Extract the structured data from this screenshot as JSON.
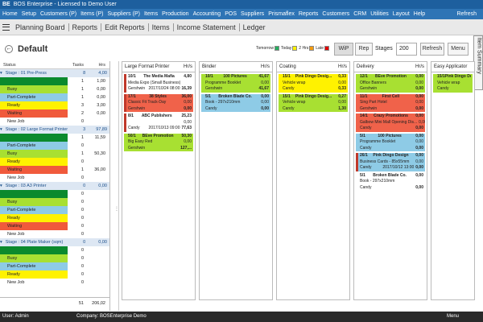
{
  "window": {
    "app_logo": "BE",
    "title": "BOS Enterprise - Licensed to Demo User"
  },
  "menu": {
    "items": [
      "Home",
      "Setup",
      "Customers (P)",
      "Items (P)",
      "Suppliers (P)",
      "Items",
      "Production",
      "Accounting",
      "POS",
      "Suppliers",
      "Prismaflex",
      "Reports",
      "Customers",
      "CRM",
      "Utilities",
      "Layout",
      "Help"
    ],
    "right": "Refresh"
  },
  "nav": {
    "items": [
      "Planning Board",
      "Reports",
      "Edit Reports",
      "Items",
      "Income Statement",
      "Ledger"
    ]
  },
  "toolbar": {
    "title": "Default",
    "back_icon": "arrow-left-icon",
    "legend": [
      {
        "label": "Tomorrow",
        "color": "#27ae60"
      },
      {
        "label": "Today",
        "color": "#fff200"
      },
      {
        "label": "2 Hrs",
        "color": "#f39c12"
      },
      {
        "label": "Late",
        "color": "#e00000"
      }
    ],
    "wip": "WiP",
    "rep": "Rep",
    "stages_label": "Stages",
    "stages_value": "200",
    "refresh": "Refresh",
    "menu": "Menu"
  },
  "side_tab": "Item Summary",
  "left": {
    "headers": {
      "status": "Status",
      "tasks": "Tasks",
      "hrs": "Hrs"
    },
    "rows": [
      {
        "t": "stage",
        "s": "Stage : 01 Pre-Press",
        "n": "8",
        "h": "4,00"
      },
      {
        "t": "status",
        "s": "",
        "n": "1",
        "h": "1,00",
        "bg": "#0b8a2d"
      },
      {
        "t": "status",
        "s": "Busy",
        "n": "1",
        "h": "0,00",
        "bg": "#a8e032"
      },
      {
        "t": "status",
        "s": "Part-Complete",
        "n": "1",
        "h": "0,00",
        "bg": "#8ecbe6"
      },
      {
        "t": "status",
        "s": "Ready",
        "n": "3",
        "h": "3,00",
        "bg": "#fff200"
      },
      {
        "t": "status",
        "s": "Waiting",
        "n": "2",
        "h": "0,00",
        "bg": "#f05a3c"
      },
      {
        "t": "status",
        "s": "New Job",
        "n": "0",
        "h": "",
        "bg": "#ffffff"
      },
      {
        "t": "stage",
        "s": "Stage : 02 Large Format Printer",
        "n": "3",
        "h": "97,89"
      },
      {
        "t": "status",
        "s": "",
        "n": "1",
        "h": "11,59",
        "bg": "#0b8a2d"
      },
      {
        "t": "status",
        "s": "Part-Complete",
        "n": "0",
        "h": "",
        "bg": "#8ecbe6"
      },
      {
        "t": "status",
        "s": "Busy",
        "n": "1",
        "h": "50,30",
        "bg": "#a8e032"
      },
      {
        "t": "status",
        "s": "Ready",
        "n": "0",
        "h": "",
        "bg": "#fff200"
      },
      {
        "t": "status",
        "s": "Waiting",
        "n": "1",
        "h": "36,00",
        "bg": "#f05a3c"
      },
      {
        "t": "status",
        "s": "New Job",
        "n": "0",
        "h": "",
        "bg": "#ffffff"
      },
      {
        "t": "stage",
        "s": "Stage : 03 A3 Printer",
        "n": "0",
        "h": "0,00"
      },
      {
        "t": "status",
        "s": "",
        "n": "0",
        "h": "",
        "bg": "#0b8a2d"
      },
      {
        "t": "status",
        "s": "Busy",
        "n": "0",
        "h": "",
        "bg": "#a8e032"
      },
      {
        "t": "status",
        "s": "Part-Complete",
        "n": "0",
        "h": "",
        "bg": "#8ecbe6"
      },
      {
        "t": "status",
        "s": "Ready",
        "n": "0",
        "h": "",
        "bg": "#fff200"
      },
      {
        "t": "status",
        "s": "Waiting",
        "n": "0",
        "h": "",
        "bg": "#f05a3c"
      },
      {
        "t": "status",
        "s": "New Job",
        "n": "0",
        "h": "",
        "bg": "#ffffff"
      },
      {
        "t": "stage",
        "s": "Stage : 04 Plate Maker (sqm)",
        "n": "0",
        "h": "0,00"
      },
      {
        "t": "status",
        "s": "",
        "n": "0",
        "h": "",
        "bg": "#0b8a2d"
      },
      {
        "t": "status",
        "s": "Busy",
        "n": "0",
        "h": "",
        "bg": "#a8e032"
      },
      {
        "t": "status",
        "s": "Part-Complete",
        "n": "0",
        "h": "",
        "bg": "#8ecbe6"
      },
      {
        "t": "status",
        "s": "Ready",
        "n": "0",
        "h": "",
        "bg": "#fff200"
      },
      {
        "t": "status",
        "s": "New Job",
        "n": "0",
        "h": "",
        "bg": "#ffffff"
      }
    ],
    "footer": {
      "tasks": "51",
      "hrs": "206,02"
    }
  },
  "columns": [
    {
      "name": "Large Format Printer",
      "hrs": "Hr/s",
      "cards": [
        {
          "bg": "#ffffff",
          "bar": "#c0392b",
          "rows": [
            [
              "10/1",
              "The Media Mafia",
              "4,80"
            ],
            [
              "Media Expo (Small Business)",
              "",
              ""
            ],
            [
              "Gershwin",
              "2017/10/24   08:00",
              "16,39"
            ]
          ]
        },
        {
          "bg": "#f0624a",
          "bar": "#c0392b",
          "rows": [
            [
              "17/1",
              "38 Styles",
              "36,00"
            ],
            [
              "Classic Fit Track-Day",
              "",
              "0,00"
            ],
            [
              "Gershwin",
              "",
              "0,00"
            ]
          ]
        },
        {
          "bg": "#ffffff",
          "bar": "#c0392b",
          "rows": [
            [
              "8/1",
              "ABC Publishers",
              "25,23"
            ],
            [
              "",
              "",
              "0,00"
            ],
            [
              "Candy",
              "2017/10/13   09:00",
              "77,63"
            ]
          ]
        },
        {
          "bg": "#a8e032",
          "bar": "#a8e032",
          "rows": [
            [
              "50/1",
              "BEve Promotion",
              "50,30"
            ],
            [
              "Big Easy Red",
              "",
              "0,00"
            ],
            [
              "Gershwin",
              "",
              "127,..."
            ]
          ]
        }
      ]
    },
    {
      "name": "Binder",
      "hrs": "Hr/s",
      "cards": [
        {
          "bg": "#a8e032",
          "bar": "#a8e032",
          "rows": [
            [
              "10/1",
              "100 Pictures",
              "41,67"
            ],
            [
              "Programme Booklet",
              "",
              "0,00"
            ],
            [
              "Gershwin",
              "",
              "41,67"
            ]
          ]
        },
        {
          "bg": "#8ecbe6",
          "bar": "#8ecbe6",
          "rows": [
            [
              "5/1",
              "Broken Blade Co.",
              "0,00"
            ],
            [
              "Book - 297x210mm",
              "",
              "0,00"
            ],
            [
              "Candy",
              "",
              "0,00"
            ]
          ]
        }
      ]
    },
    {
      "name": "Coating",
      "hrs": "Hr/s",
      "cards": [
        {
          "bg": "#fff200",
          "bar": "#fff200",
          "rows": [
            [
              "15/1",
              "Pink Dingo Desig...",
              "0,33"
            ],
            [
              "Vehicle wrap",
              "",
              "0,00"
            ],
            [
              "Candy",
              "",
              "0,33"
            ]
          ]
        },
        {
          "bg": "#a8e032",
          "bar": "#a8e032",
          "rows": [
            [
              "15/1",
              "Pink Dingo Desig...",
              "0,27"
            ],
            [
              "Vehicle wrap",
              "",
              "0,00"
            ],
            [
              "Candy",
              "",
              "1,30"
            ]
          ]
        }
      ]
    },
    {
      "name": "Delivery",
      "hrs": "Hr/s",
      "cards": [
        {
          "bg": "#a8e032",
          "bar": "#a8e032",
          "rows": [
            [
              "12/1",
              "BEve Promotion",
              "0,00"
            ],
            [
              "Office Banners",
              "",
              "0,00"
            ],
            [
              "Gershwin",
              "",
              "0,00"
            ]
          ]
        },
        {
          "bg": "#f0624a",
          "bar": "#f0624a",
          "rows": [
            [
              "11/1",
              "First Cell",
              "0,00"
            ],
            [
              "Sing Part Hotel",
              "",
              "0,00"
            ],
            [
              "Gershwin",
              "",
              "0,00"
            ]
          ]
        },
        {
          "bg": "#f0624a",
          "bar": "#f0624a",
          "rows": [
            [
              "14/1",
              "Crazy Promotions",
              "0,00"
            ],
            [
              "Galbow Mini Mall Opening Dis...",
              "",
              "0,00"
            ],
            [
              "Candy",
              "",
              "0,00"
            ]
          ]
        },
        {
          "bg": "#8ecbe6",
          "bar": "#8ecbe6",
          "rows": [
            [
              "5/1",
              "100 Pictures",
              "0,00"
            ],
            [
              "Programme Booklet",
              "",
              "0,00"
            ],
            [
              "Candy",
              "",
              "0,00"
            ]
          ]
        },
        {
          "bg": "#8ecbe6",
          "bar": "#c0392b",
          "rows": [
            [
              "26/1",
              "Pink Dingo Design",
              "0,00"
            ],
            [
              "Business Cards - 85x55mm",
              "",
              "0,00"
            ],
            [
              "Candy",
              "2017/10/12   13:00",
              "0,00"
            ]
          ]
        },
        {
          "bg": "#ffffff",
          "bar": "#ffffff",
          "rows": [
            [
              "5/1",
              "Broken Blade Co.",
              "0,00"
            ],
            [
              "Book - 297x210mm",
              "",
              ""
            ],
            [
              "Candy",
              "",
              "0,00"
            ]
          ]
        }
      ]
    },
    {
      "name": "Easy Applicator",
      "hrs": "",
      "cards": [
        {
          "bg": "#a8e032",
          "bar": "#a8e032",
          "rows": [
            [
              "15/1",
              "Pink Dingo Desig...",
              ""
            ],
            [
              "Vehicle wrap",
              "",
              ""
            ],
            [
              "Candy",
              "",
              ""
            ]
          ]
        }
      ]
    }
  ],
  "status": {
    "user": "User: Admin",
    "company": "Company: BOSEnterprise Demo",
    "menu": "Menu"
  }
}
